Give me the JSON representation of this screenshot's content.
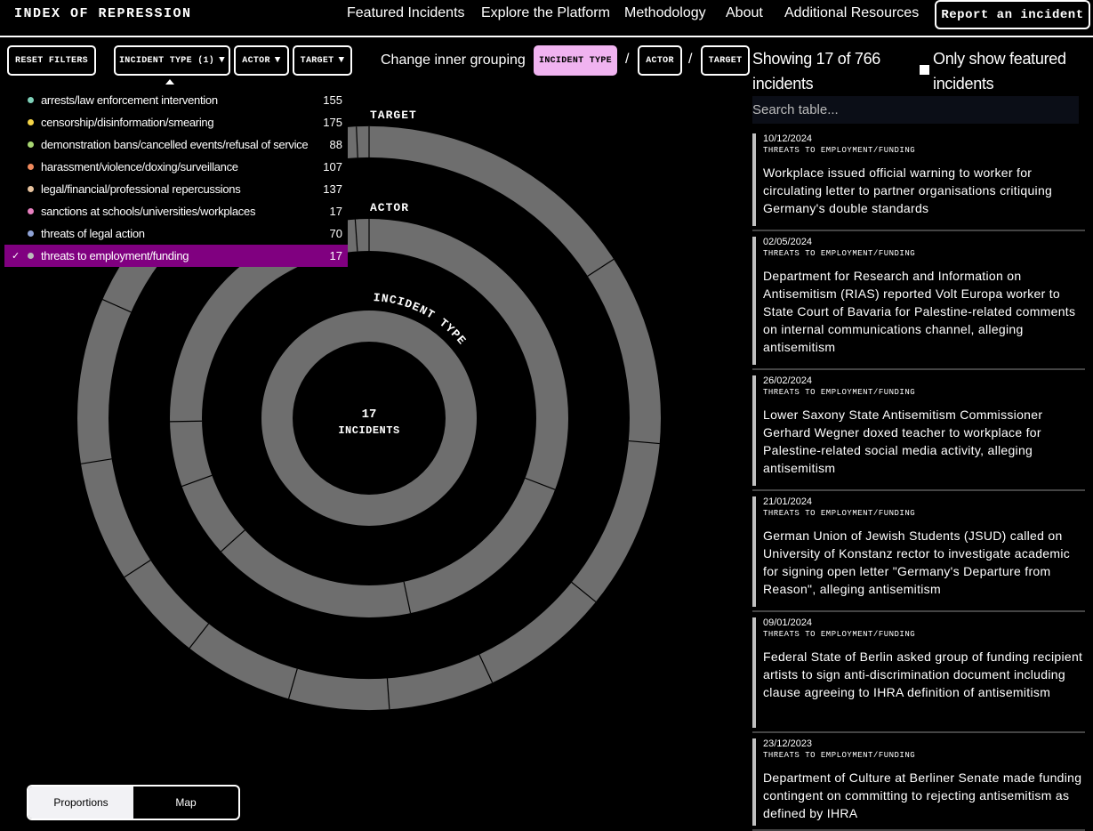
{
  "header": {
    "logo": "INDEX OF REPRESSION",
    "nav": [
      "Featured Incidents",
      "Explore the Platform",
      "Methodology",
      "About",
      "Additional Resources"
    ],
    "report_button": "Report an incident"
  },
  "filters": {
    "reset": "RESET FILTERS",
    "incident_type": "INCIDENT TYPE (1)",
    "actor": "ACTOR",
    "target": "TARGET",
    "caret": "▼"
  },
  "grouping": {
    "label": "Change inner grouping",
    "options": [
      "INCIDENT TYPE",
      "ACTOR",
      "TARGET"
    ],
    "separator": "/",
    "active": "INCIDENT TYPE"
  },
  "dropdown": {
    "check": "✓",
    "items": [
      {
        "label": "arrests/law enforcement intervention",
        "count": "155",
        "color": "#7fd1b9",
        "selected": false
      },
      {
        "label": "censorship/disinformation/smearing",
        "count": "175",
        "color": "#f5d547",
        "selected": false
      },
      {
        "label": "demonstration bans/cancelled events/refusal of service",
        "count": "88",
        "color": "#a8d672",
        "selected": false
      },
      {
        "label": "harassment/violence/doxing/surveillance",
        "count": "107",
        "color": "#f08a5d",
        "selected": false
      },
      {
        "label": "legal/financial/professional repercussions",
        "count": "137",
        "color": "#e8c39e",
        "selected": false
      },
      {
        "label": "sanctions at schools/universities/workplaces",
        "count": "17",
        "color": "#e880c0",
        "selected": false
      },
      {
        "label": "threats of legal action",
        "count": "70",
        "color": "#8fa3d6",
        "selected": false
      },
      {
        "label": "threats to employment/funding",
        "count": "17",
        "color": "#bbbbbb",
        "selected": true
      }
    ]
  },
  "chart": {
    "ring_labels": [
      "TARGET",
      "ACTOR",
      "INCIDENT TYPE"
    ],
    "center_count": "17",
    "center_label": "INCIDENTS",
    "ring_color": "#6e6e6e"
  },
  "view_toggle": {
    "options": [
      "Proportions",
      "Map"
    ],
    "active": "Proportions"
  },
  "results": {
    "showing": "Showing 17 of 766 incidents",
    "featured_only": "Only show featured incidents",
    "search_placeholder": "Search table...",
    "cards": [
      {
        "date": "10/12/2024",
        "type": "THREATS TO EMPLOYMENT/FUNDING",
        "title": "Workplace issued official warning to worker for circulating letter to partner organisations critiquing Germany's double standards"
      },
      {
        "date": "02/05/2024",
        "type": "THREATS TO EMPLOYMENT/FUNDING",
        "title": "Department for Research and Information on Antisemitism (RIAS) reported Volt Europa worker to State Court of Bavaria for Palestine-related comments on internal communications channel, alleging antisemitism"
      },
      {
        "date": "26/02/2024",
        "type": "THREATS TO EMPLOYMENT/FUNDING",
        "title": "Lower Saxony State Antisemitism Commissioner Gerhard Wegner doxed teacher to workplace for Palestine-related social media activity, alleging antisemitism"
      },
      {
        "date": "21/01/2024",
        "type": "THREATS TO EMPLOYMENT/FUNDING",
        "title": "German Union of Jewish Students (JSUD) called on University of Konstanz rector to investigate academic for signing open letter \"Germany's Departure from Reason\", alleging antisemitism"
      },
      {
        "date": "09/01/2024",
        "type": "THREATS TO EMPLOYMENT/FUNDING",
        "title": "Federal State of Berlin asked group of funding recipient artists to sign anti-discrimination document including clause agreeing to IHRA definition of antisemitism"
      },
      {
        "date": "23/12/2023",
        "type": "THREATS TO EMPLOYMENT/FUNDING",
        "title": "Department of Culture at Berliner Senate made funding contingent on committing to rejecting antisemitism as defined by IHRA"
      }
    ]
  }
}
